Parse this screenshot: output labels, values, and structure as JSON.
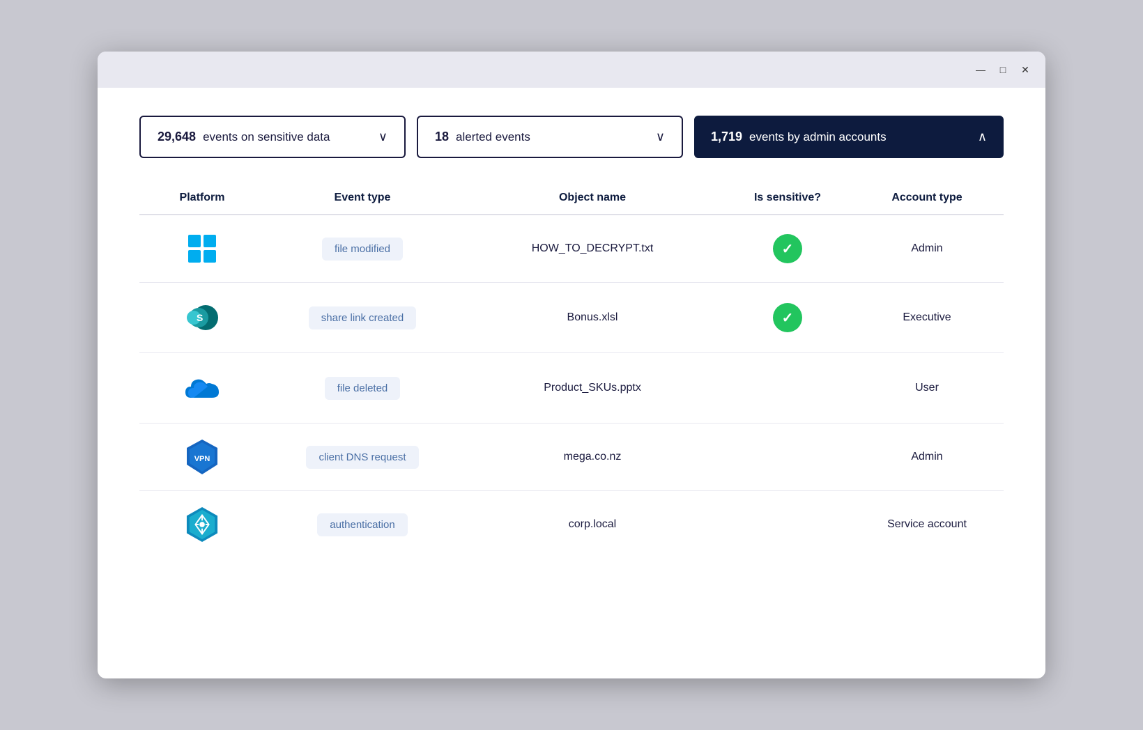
{
  "window": {
    "titlebar": {
      "minimize": "—",
      "maximize": "□",
      "close": "✕"
    }
  },
  "filters": [
    {
      "count": "29,648",
      "label": "events on sensitive data",
      "type": "outline",
      "chevron": "∨"
    },
    {
      "count": "18",
      "label": "alerted events",
      "type": "outline",
      "chevron": "∨"
    },
    {
      "count": "1,719",
      "label": "events by admin accounts",
      "type": "filled",
      "chevron": "∧"
    }
  ],
  "table": {
    "headers": [
      "Platform",
      "Event type",
      "Object name",
      "Is sensitive?",
      "Account type"
    ],
    "rows": [
      {
        "platform": "windows",
        "eventType": "file modified",
        "objectName": "HOW_TO_DECRYPT.txt",
        "isSensitive": true,
        "accountType": "Admin"
      },
      {
        "platform": "sharepoint",
        "eventType": "share link created",
        "objectName": "Bonus.xlsl",
        "isSensitive": true,
        "accountType": "Executive"
      },
      {
        "platform": "onedrive",
        "eventType": "file deleted",
        "objectName": "Product_SKUs.pptx",
        "isSensitive": false,
        "accountType": "User"
      },
      {
        "platform": "vpn",
        "eventType": "client DNS request",
        "objectName": "mega.co.nz",
        "isSensitive": false,
        "accountType": "Admin"
      },
      {
        "platform": "activedirectory",
        "eventType": "authentication",
        "objectName": "corp.local",
        "isSensitive": false,
        "accountType": "Service account"
      }
    ]
  }
}
